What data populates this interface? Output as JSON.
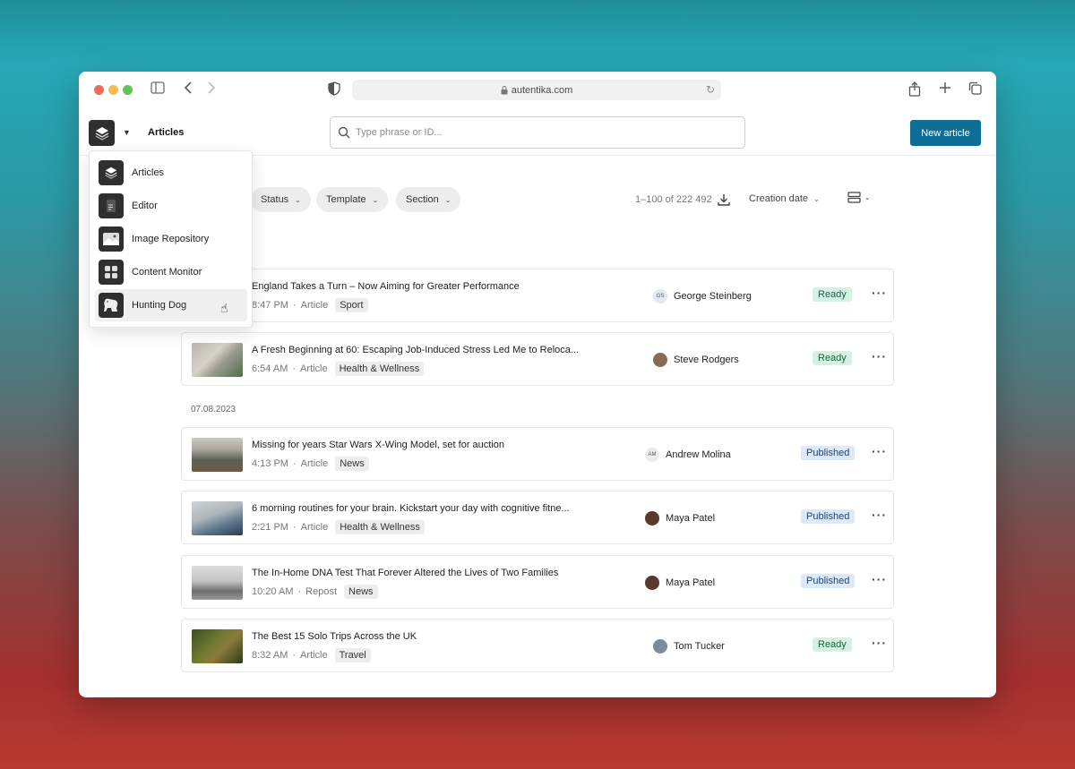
{
  "browser": {
    "url": "autentika.com"
  },
  "header": {
    "title": "Articles",
    "search_placeholder": "Type phrase or ID...",
    "new_button": "New article"
  },
  "filters": {
    "items": [
      "Status",
      "Template",
      "Section"
    ]
  },
  "results": {
    "count": "1–100 of 222 492",
    "sort_label": "Creation date"
  },
  "groups": {
    "day2_label": "07.08.2023"
  },
  "articles": [
    {
      "title": "England Takes a Turn – Now Aiming for Greater Performance",
      "time": "8:47 PM",
      "type": "Article",
      "tag": "Sport",
      "author": "George Steinberg",
      "author_initials": "GS",
      "status": "Ready"
    },
    {
      "title": "A Fresh Beginning at 60: Escaping Job-Induced Stress Led Me to Reloca...",
      "time": "6:54 AM",
      "type": "Article",
      "tag": "Health & Wellness",
      "author": "Steve Rodgers",
      "status": "Ready"
    },
    {
      "title": "Missing for years Star Wars X-Wing Model, set for auction",
      "time": "4:13 PM",
      "type": "Article",
      "tag": "News",
      "author": "Andrew Molina",
      "author_initials": "AM",
      "status": "Published"
    },
    {
      "title": "6 morning routines for your brain. Kickstart your day with cognitive fitne...",
      "time": "2:21 PM",
      "type": "Article",
      "tag": "Health & Wellness",
      "author": "Maya Patel",
      "status": "Published"
    },
    {
      "title": "The In-Home DNA Test That Forever Altered the Lives of Two Families",
      "time": "10:20 AM",
      "type": "Repost",
      "tag": "News",
      "author": "Maya Patel",
      "status": "Published"
    },
    {
      "title": "The Best 15 Solo Trips Across the UK",
      "time": "8:32 AM",
      "type": "Article",
      "tag": "Travel",
      "author": "Tom Tucker",
      "status": "Ready"
    }
  ],
  "menu": {
    "items": [
      "Articles",
      "Editor",
      "Image Repository",
      "Content Monitor",
      "Hunting Dog"
    ]
  },
  "colors": {
    "primary": "#0f6e95",
    "ready_bg": "#d4f3e5",
    "published_bg": "#dce9fb"
  }
}
